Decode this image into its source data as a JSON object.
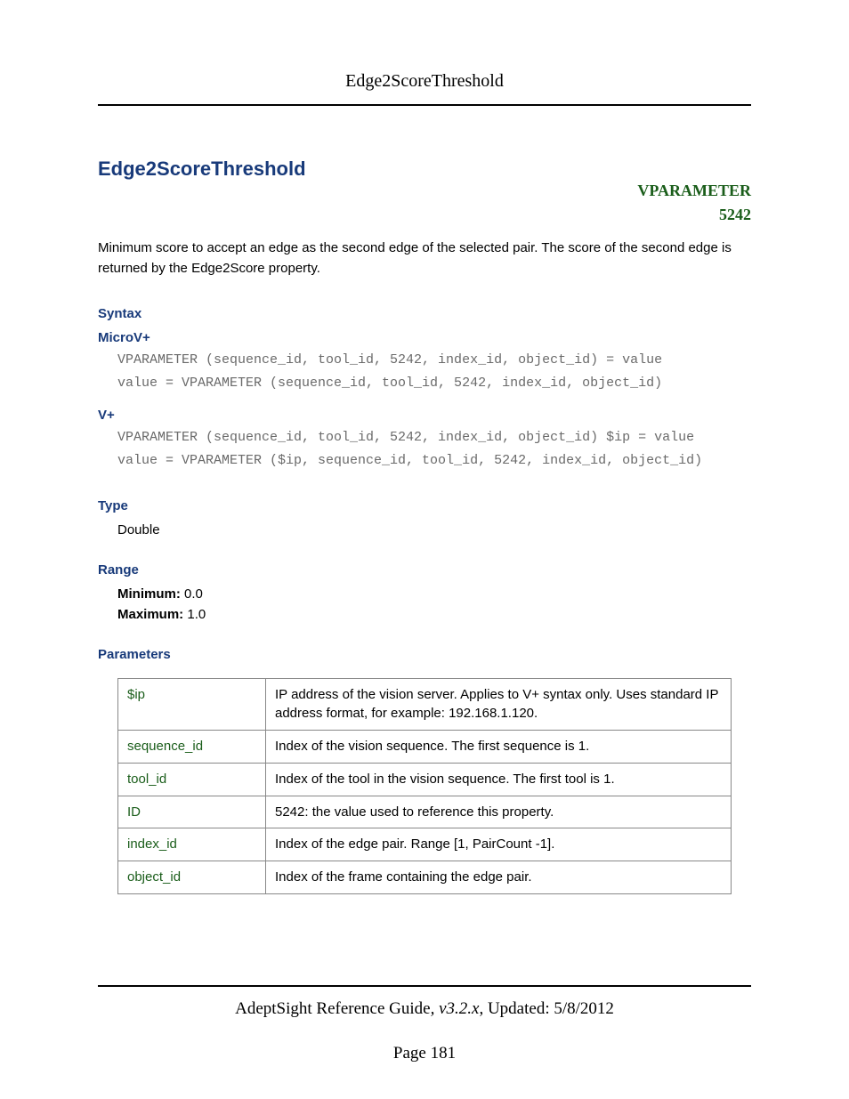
{
  "header": "Edge2ScoreThreshold",
  "title": "Edge2ScoreThreshold",
  "vparam": {
    "label": "VPARAMETER",
    "id": "5242"
  },
  "description": "Minimum score to accept an edge as the second edge of the selected pair. The score of the second edge is returned by the Edge2Score property.",
  "sections": {
    "syntax": {
      "heading": "Syntax",
      "microv": {
        "label": "MicroV+",
        "code": "VPARAMETER (sequence_id, tool_id, 5242, index_id, object_id) = value\nvalue = VPARAMETER (sequence_id, tool_id, 5242, index_id, object_id)"
      },
      "vplus": {
        "label": "V+",
        "code": "VPARAMETER (sequence_id, tool_id, 5242, index_id, object_id) $ip = value\nvalue = VPARAMETER ($ip, sequence_id, tool_id, 5242, index_id, object_id)"
      }
    },
    "type": {
      "heading": "Type",
      "value": "Double"
    },
    "range": {
      "heading": "Range",
      "min_label": "Minimum:",
      "min_value": " 0.0",
      "max_label": "Maximum:",
      "max_value": " 1.0"
    },
    "parameters": {
      "heading": "Parameters",
      "rows": [
        {
          "name": "$ip",
          "desc": "IP address of the vision server. Applies to V+ syntax only. Uses standard IP address format, for example: 192.168.1.120."
        },
        {
          "name": "sequence_id",
          "desc": "Index of the vision sequence. The first sequence is 1."
        },
        {
          "name": "tool_id",
          "desc": "Index of the tool in the vision sequence. The first tool is 1."
        },
        {
          "name": "ID",
          "desc": "5242: the value used to reference this property."
        },
        {
          "name": "index_id",
          "desc": "Index of the edge pair. Range [1, PairCount -1]."
        },
        {
          "name": "object_id",
          "desc": "Index of the frame containing the edge pair."
        }
      ]
    }
  },
  "footer": {
    "guide": "AdeptSight Reference Guide",
    "version": ", v3.2.x",
    "updated": ", Updated: 5/8/2012",
    "page": "Page 181"
  }
}
